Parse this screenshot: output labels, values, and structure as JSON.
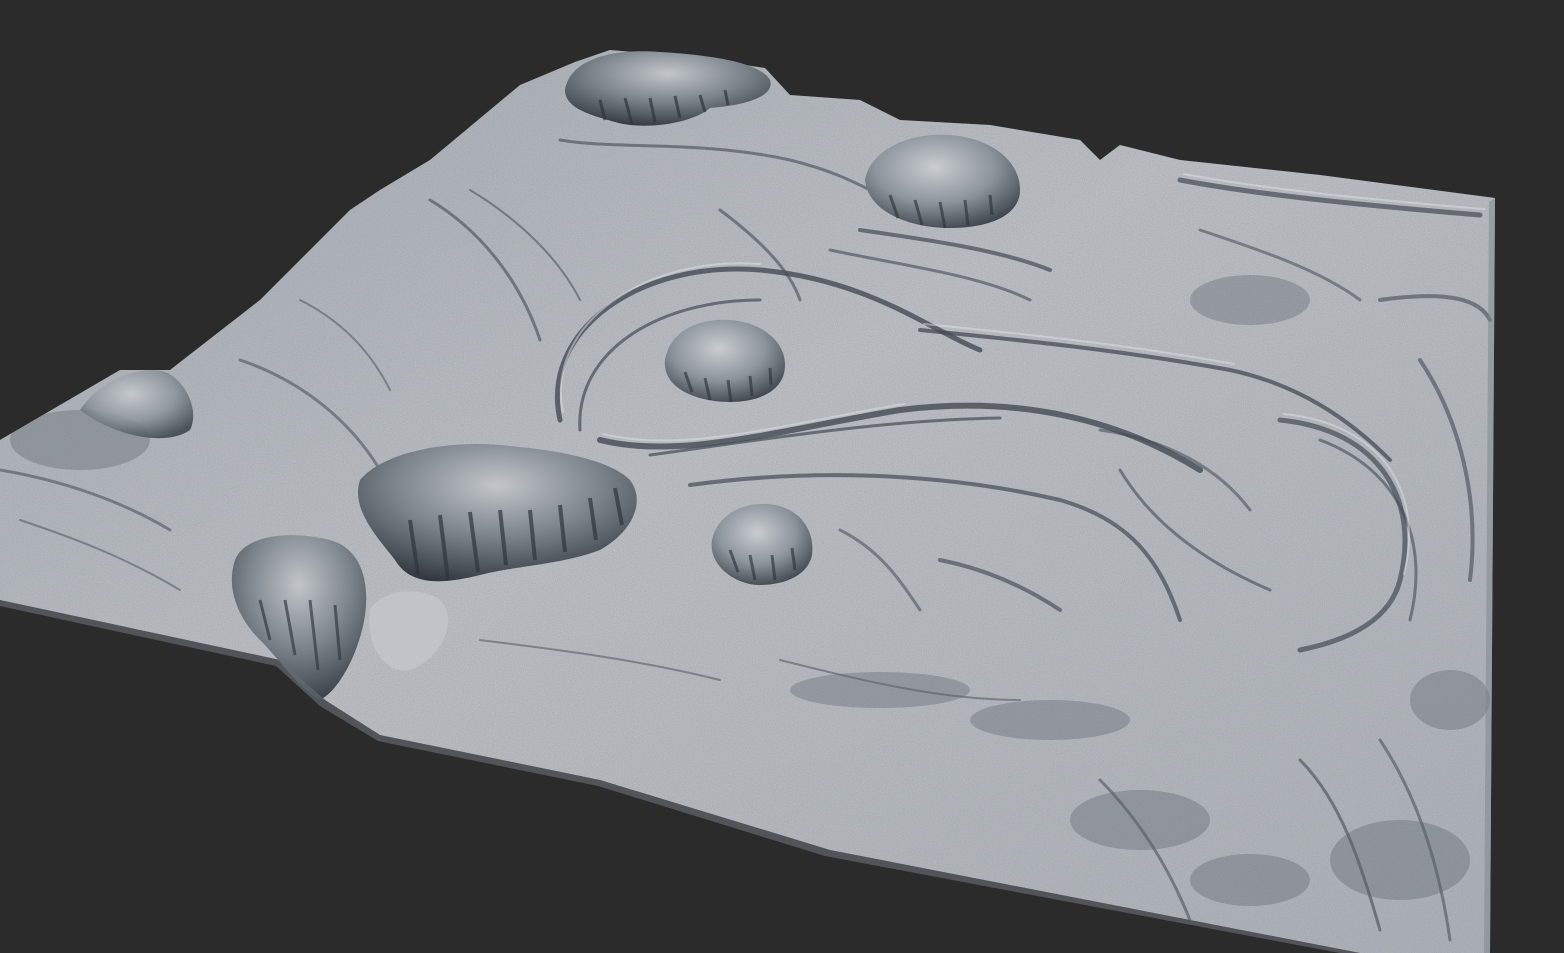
{
  "viewport": {
    "background_color": "#2b2b2b"
  },
  "terrain": {
    "base_color": "#b9bdc2",
    "light_color": "#d6d9dc",
    "shadow_color": "#4a5058",
    "deep_shadow_color": "#2f343b"
  }
}
